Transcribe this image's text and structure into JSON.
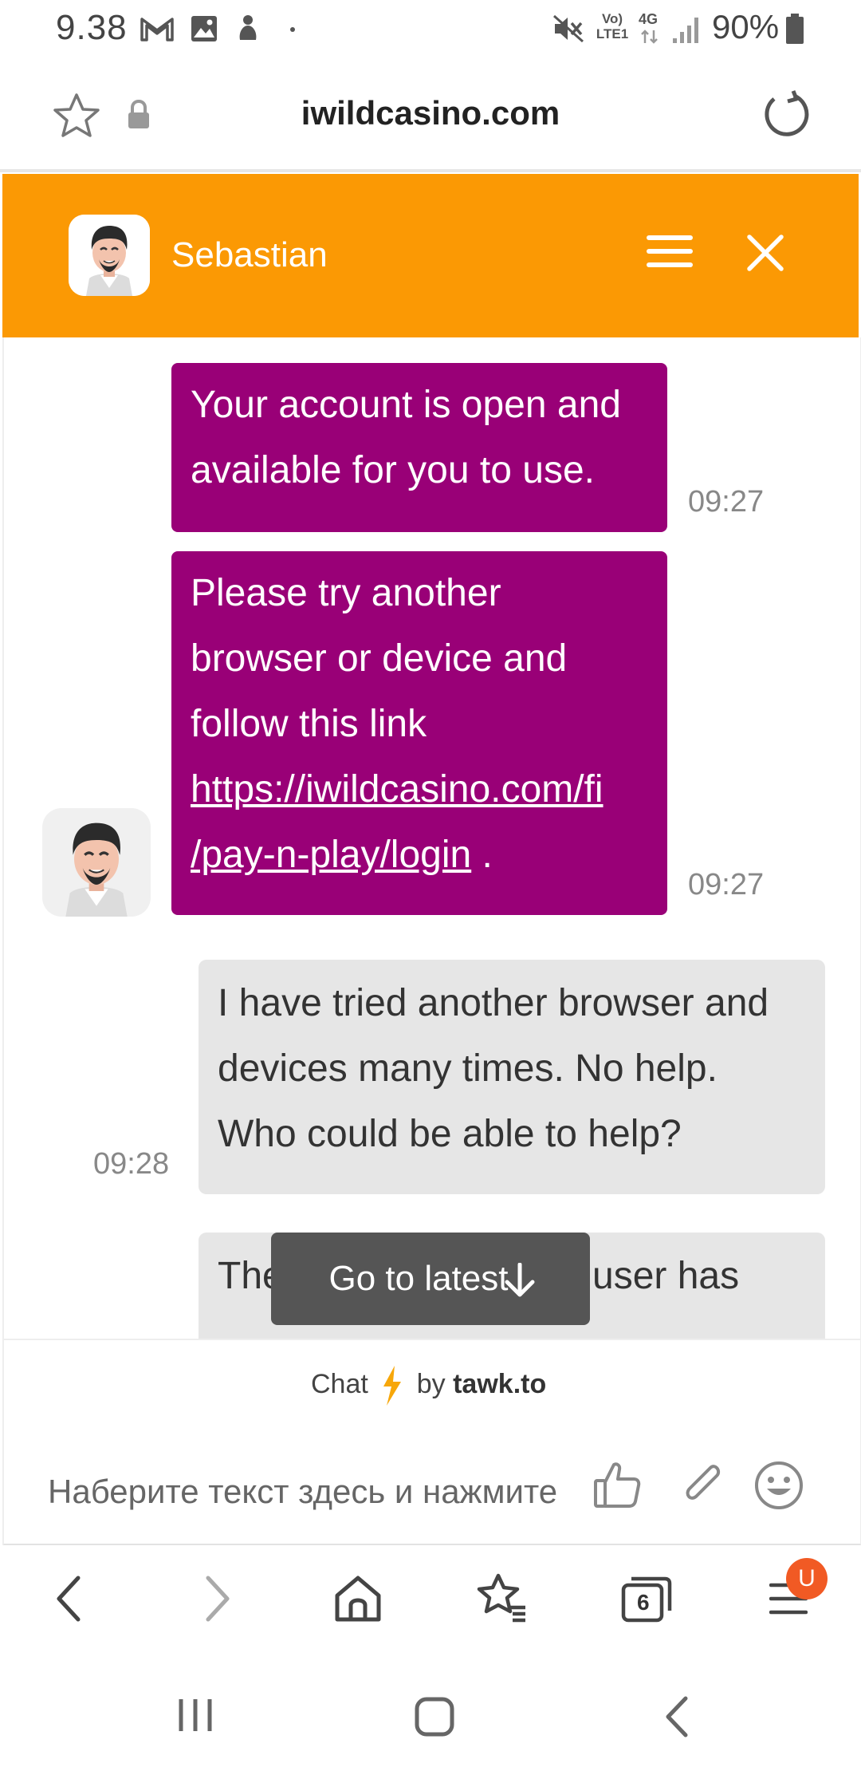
{
  "status_bar": {
    "time": "9.38",
    "battery": "90%",
    "network_lte": "Vo) LTE1",
    "network_4g": "4G"
  },
  "browser": {
    "url": "iwildcasino.com",
    "tab_count": "6",
    "menu_badge": "U"
  },
  "chat": {
    "agent_name": "Sebastian",
    "accent_color": "#fb9904",
    "agent_bubble_color": "#990077",
    "messages": [
      {
        "from": "agent",
        "lines": [
          "Your account is open and",
          "available for you to use."
        ],
        "time": "09:27"
      },
      {
        "from": "agent",
        "lines": [
          "Please try another",
          "browser or device and",
          "follow this link"
        ],
        "link_line1": "https://iwildcasino.com/fi",
        "link_line2": "/pay-n-play/login",
        "link_suffix": " .",
        "time": "09:27"
      },
      {
        "from": "user",
        "lines": [
          "I have tried another browser and",
          "devices many times. No help.",
          "Who could be able to help?"
        ],
        "time": "09:28"
      },
      {
        "from": "user",
        "partial_start": "The",
        "partial_end": "user has"
      }
    ],
    "go_to_latest": "Go to latest",
    "powered_by_prefix": "Chat",
    "powered_by_middle": "by",
    "powered_by_brand": "tawk.to",
    "input_placeholder": "Наберите текст здесь и нажмите"
  },
  "icons": {
    "status": [
      "gmail-icon",
      "gallery-icon",
      "notification-icon",
      "mute-icon",
      "signal-icon",
      "battery-icon"
    ],
    "address": [
      "star-icon",
      "lock-icon",
      "reload-icon"
    ],
    "header": [
      "menu-icon",
      "close-icon"
    ],
    "footer": [
      "thumbs-up-icon",
      "attach-icon",
      "emoji-icon"
    ],
    "browser_nav": [
      "back-icon",
      "forward-icon",
      "home-icon",
      "bookmarks-icon",
      "tabs-icon",
      "menu-icon"
    ],
    "system_nav": [
      "recents-icon",
      "home-button-icon",
      "system-back-icon"
    ]
  }
}
